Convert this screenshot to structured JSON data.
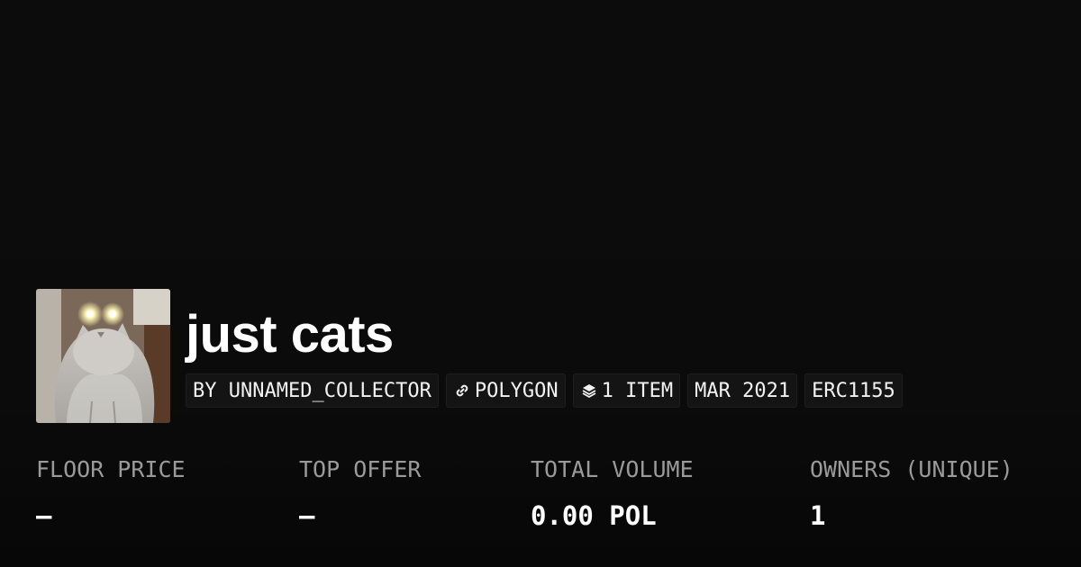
{
  "collection": {
    "name": "just cats",
    "tags": {
      "creator": "BY UNNAMED_COLLECTOR",
      "chain": "POLYGON",
      "items": "1 ITEM",
      "created": "MAR 2021",
      "standard": "ERC1155"
    },
    "tag_icons": {
      "chain": "chain-link-icon",
      "items": "layers-stack-icon"
    }
  },
  "stats": {
    "floor_price": {
      "label": "FLOOR PRICE",
      "value": "–"
    },
    "top_offer": {
      "label": "TOP OFFER",
      "value": "–"
    },
    "total_volume": {
      "label": "TOTAL VOLUME",
      "value": "0.00 POL"
    },
    "owners": {
      "label": "OWNERS (UNIQUE)",
      "value": "1"
    }
  },
  "colors": {
    "background": "#0b0b0b",
    "tag_background": "#141414",
    "label": "#9a9a9a",
    "text": "#ffffff"
  }
}
